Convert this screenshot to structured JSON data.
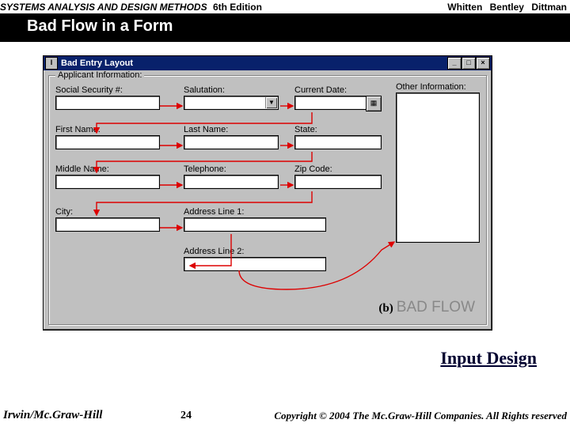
{
  "header": {
    "book_title": "SYSTEMS ANALYSIS AND DESIGN METHODS",
    "edition": "6th Edition",
    "authors": [
      "Whitten",
      "Bentley",
      "Dittman"
    ]
  },
  "slide_title": "Bad Flow in a Form",
  "window": {
    "title": "Bad Entry Layout",
    "controls": {
      "minimize": "_",
      "maximize": "□",
      "close": "×"
    },
    "group_label": "Applicant Information:",
    "fields": {
      "ssn": "Social Security #:",
      "salutation": "Salutation:",
      "current_date": "Current Date:",
      "other_info": "Other Information:",
      "first_name": "First Name:",
      "last_name": "Last Name:",
      "state": "State:",
      "middle_name": "Middle Name:",
      "telephone": "Telephone:",
      "zip": "Zip Code:",
      "city": "City:",
      "addr1": "Address Line 1:",
      "addr2": "Address Line 2:"
    },
    "annotation": {
      "tag": "(b)",
      "label": "BAD FLOW"
    }
  },
  "lower_link": "Input Design",
  "footer": {
    "publisher": "Irwin/Mc.Graw-Hill",
    "page": "24",
    "copyright": "Copyright © 2004 The Mc.Graw-Hill Companies. All Rights reserved"
  }
}
